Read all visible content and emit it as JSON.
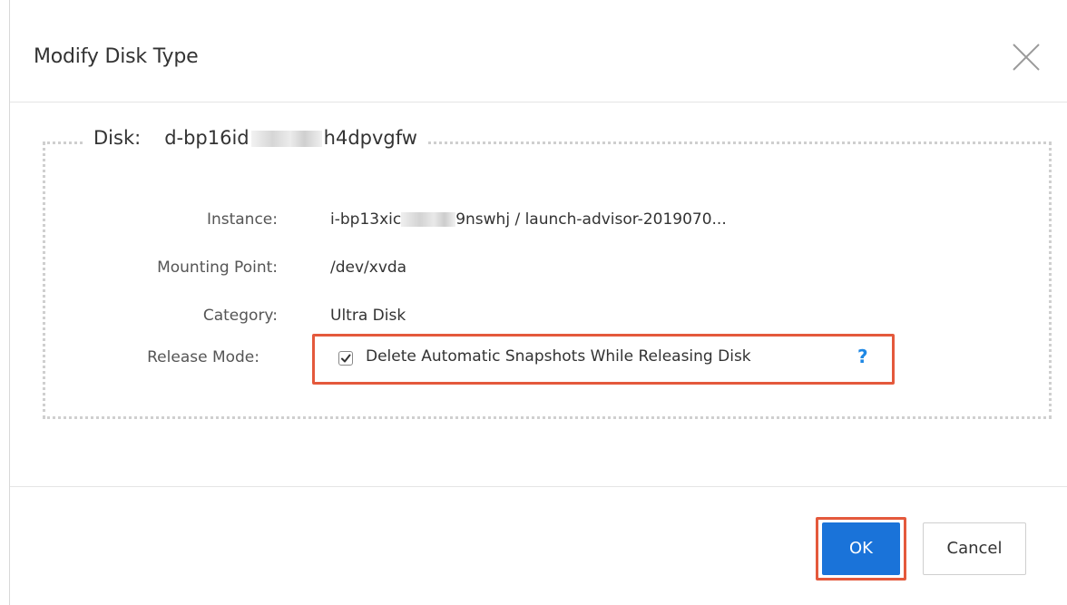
{
  "dialog": {
    "title": "Modify Disk Type",
    "close_icon": "close-icon"
  },
  "disk": {
    "label": "Disk:",
    "id_prefix": "d-bp16id",
    "id_suffix": "h4dpvgfw"
  },
  "fields": {
    "instance_label": "Instance:",
    "instance_prefix": "i-bp13xic",
    "instance_suffix": "9nswhj / launch-advisor-2019070...",
    "mount_label": "Mounting Point:",
    "mount_value": "/dev/xvda",
    "category_label": "Category:",
    "category_value": "Ultra Disk",
    "release_label": "Release Mode:",
    "release_checkbox_label": "Delete Automatic Snapshots While Releasing Disk",
    "release_checked": true,
    "help_text": "?"
  },
  "footer": {
    "ok_label": "OK",
    "cancel_label": "Cancel"
  },
  "colors": {
    "primary": "#1a73d9",
    "highlight": "#e4593c",
    "help": "#1e88e5"
  }
}
